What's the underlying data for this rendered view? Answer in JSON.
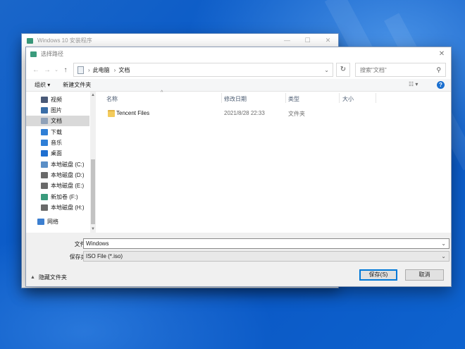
{
  "bg_window": {
    "title": "Windows 10 安装程序"
  },
  "dialog": {
    "title": "选择路径",
    "close": "✕",
    "nav": {
      "back": "←",
      "forward": "→",
      "up": "↑"
    },
    "breadcrumb": [
      "此电脑",
      "文档"
    ],
    "search_placeholder": "搜索\"文档\"",
    "toolbar": {
      "organize": "组织 ▾",
      "new_folder": "新建文件夹"
    },
    "sidebar": [
      {
        "label": "视频",
        "icon": "video-icon",
        "color": "#4a5a78"
      },
      {
        "label": "图片",
        "icon": "pictures-icon",
        "color": "#3a6ea8"
      },
      {
        "label": "文档",
        "icon": "documents-icon",
        "color": "#8fa1b8",
        "selected": true
      },
      {
        "label": "下载",
        "icon": "download-icon",
        "color": "#2f7fd6"
      },
      {
        "label": "音乐",
        "icon": "music-icon",
        "color": "#2f7fd6"
      },
      {
        "label": "桌面",
        "icon": "desktop-icon",
        "color": "#1f6fd0"
      },
      {
        "label": "本地磁盘 (C:)",
        "icon": "drive-c-icon",
        "color": "#5b8fc7"
      },
      {
        "label": "本地磁盘 (D:)",
        "icon": "drive-icon",
        "color": "#6a6a6a"
      },
      {
        "label": "本地磁盘 (E:)",
        "icon": "drive-icon",
        "color": "#6a6a6a"
      },
      {
        "label": "新加卷 (F:)",
        "icon": "drive-icon",
        "color": "#3a9b7c"
      },
      {
        "label": "本地磁盘 (H:)",
        "icon": "drive-icon",
        "color": "#6a6a6a"
      },
      {
        "label": "网络",
        "icon": "network-icon",
        "color": "#3c7fd0"
      }
    ],
    "columns": [
      "名称",
      "修改日期",
      "类型",
      "大小"
    ],
    "files": [
      {
        "name": "Tencent Files",
        "modified": "2021/8/28 22:33",
        "type": "文件夹",
        "size": ""
      }
    ],
    "filename_label": "文件名(N):",
    "filename_value": "Windows",
    "filetype_label": "保存类型(T):",
    "filetype_value": "ISO File (*.iso)",
    "hide_folders": "隐藏文件夹",
    "save_button": "保存(S)",
    "cancel_button": "取消"
  }
}
